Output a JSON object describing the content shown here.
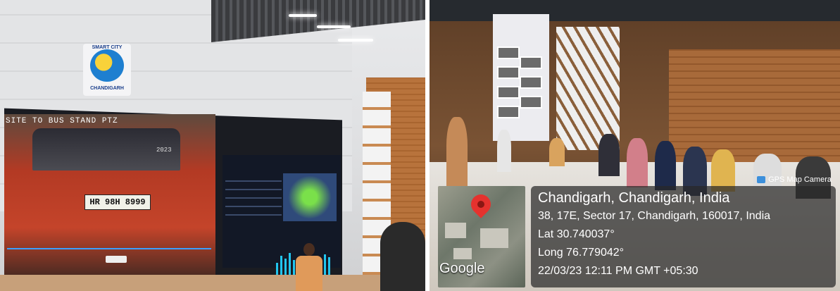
{
  "left_photo": {
    "logo_top_text": "SMART CITY",
    "logo_bottom_text": "CHANDIGARH",
    "camera_label": "SITE TO BUS STAND PTZ",
    "timestamp_partial": "2023",
    "plate_text": "HR 98H 8999"
  },
  "right_photo": {
    "badge": {
      "icon": "camera-icon",
      "label": "GPS Map Camera"
    },
    "location_title": "Chandigarh, Chandigarh, India",
    "address": "38, 17E, Sector 17, Chandigarh, 160017, India",
    "lat": "Lat 30.740037°",
    "long": "Long 76.779042°",
    "datetime": "22/03/23 12:11 PM GMT +05:30",
    "map_brand": "Google",
    "pin_icon": "map-pin-icon"
  }
}
